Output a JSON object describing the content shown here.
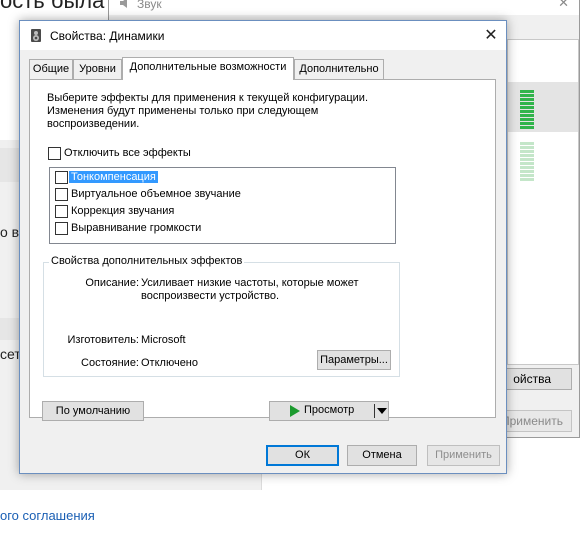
{
  "background": {
    "heading": "ость была с",
    "side_text_1": "о в",
    "side_text_2": "сет",
    "footer_link": "ого соглашения"
  },
  "sound_window": {
    "title": "Звук",
    "close": "✕",
    "properties_button": "ойства",
    "apply_button": "Применить",
    "meter_colors": {
      "active": "#31b44b",
      "inactive": "#c4e6c9"
    }
  },
  "dialog": {
    "title": "Свойства: Динамики",
    "close": "✕",
    "tabs": [
      {
        "label": "Общие",
        "active": false
      },
      {
        "label": "Уровни",
        "active": false
      },
      {
        "label": "Дополнительные возможности",
        "active": true
      },
      {
        "label": "Дополнительно",
        "active": false
      }
    ],
    "description": "Выберите эффекты для применения к текущей конфигурации. Изменения будут применены только при следующем воспроизведении.",
    "disable_all": {
      "label": "Отключить все эффекты",
      "checked": false
    },
    "effects": [
      {
        "label": "Тонкомпенсация",
        "checked": false,
        "selected": true
      },
      {
        "label": "Виртуальное объемное звучание",
        "checked": false,
        "selected": false
      },
      {
        "label": "Коррекция звучания",
        "checked": false,
        "selected": false
      },
      {
        "label": "Выравнивание громкости",
        "checked": false,
        "selected": false
      }
    ],
    "effect_props": {
      "legend": "Свойства дополнительных эффектов",
      "description_label": "Описание:",
      "description_value": "Усиливает низкие частоты, которые может воспроизвести устройство.",
      "maker_label": "Изготовитель:",
      "maker_value": "Microsoft",
      "state_label": "Состояние:",
      "state_value": "Отключено",
      "settings_button": "Параметры..."
    },
    "defaults_button": "По умолчанию",
    "preview_button": "Просмотр",
    "ok_button": "ОК",
    "cancel_button": "Отмена",
    "apply_button": "Применить",
    "accent_color": "#0078d7",
    "selection_color": "#3399ff"
  }
}
